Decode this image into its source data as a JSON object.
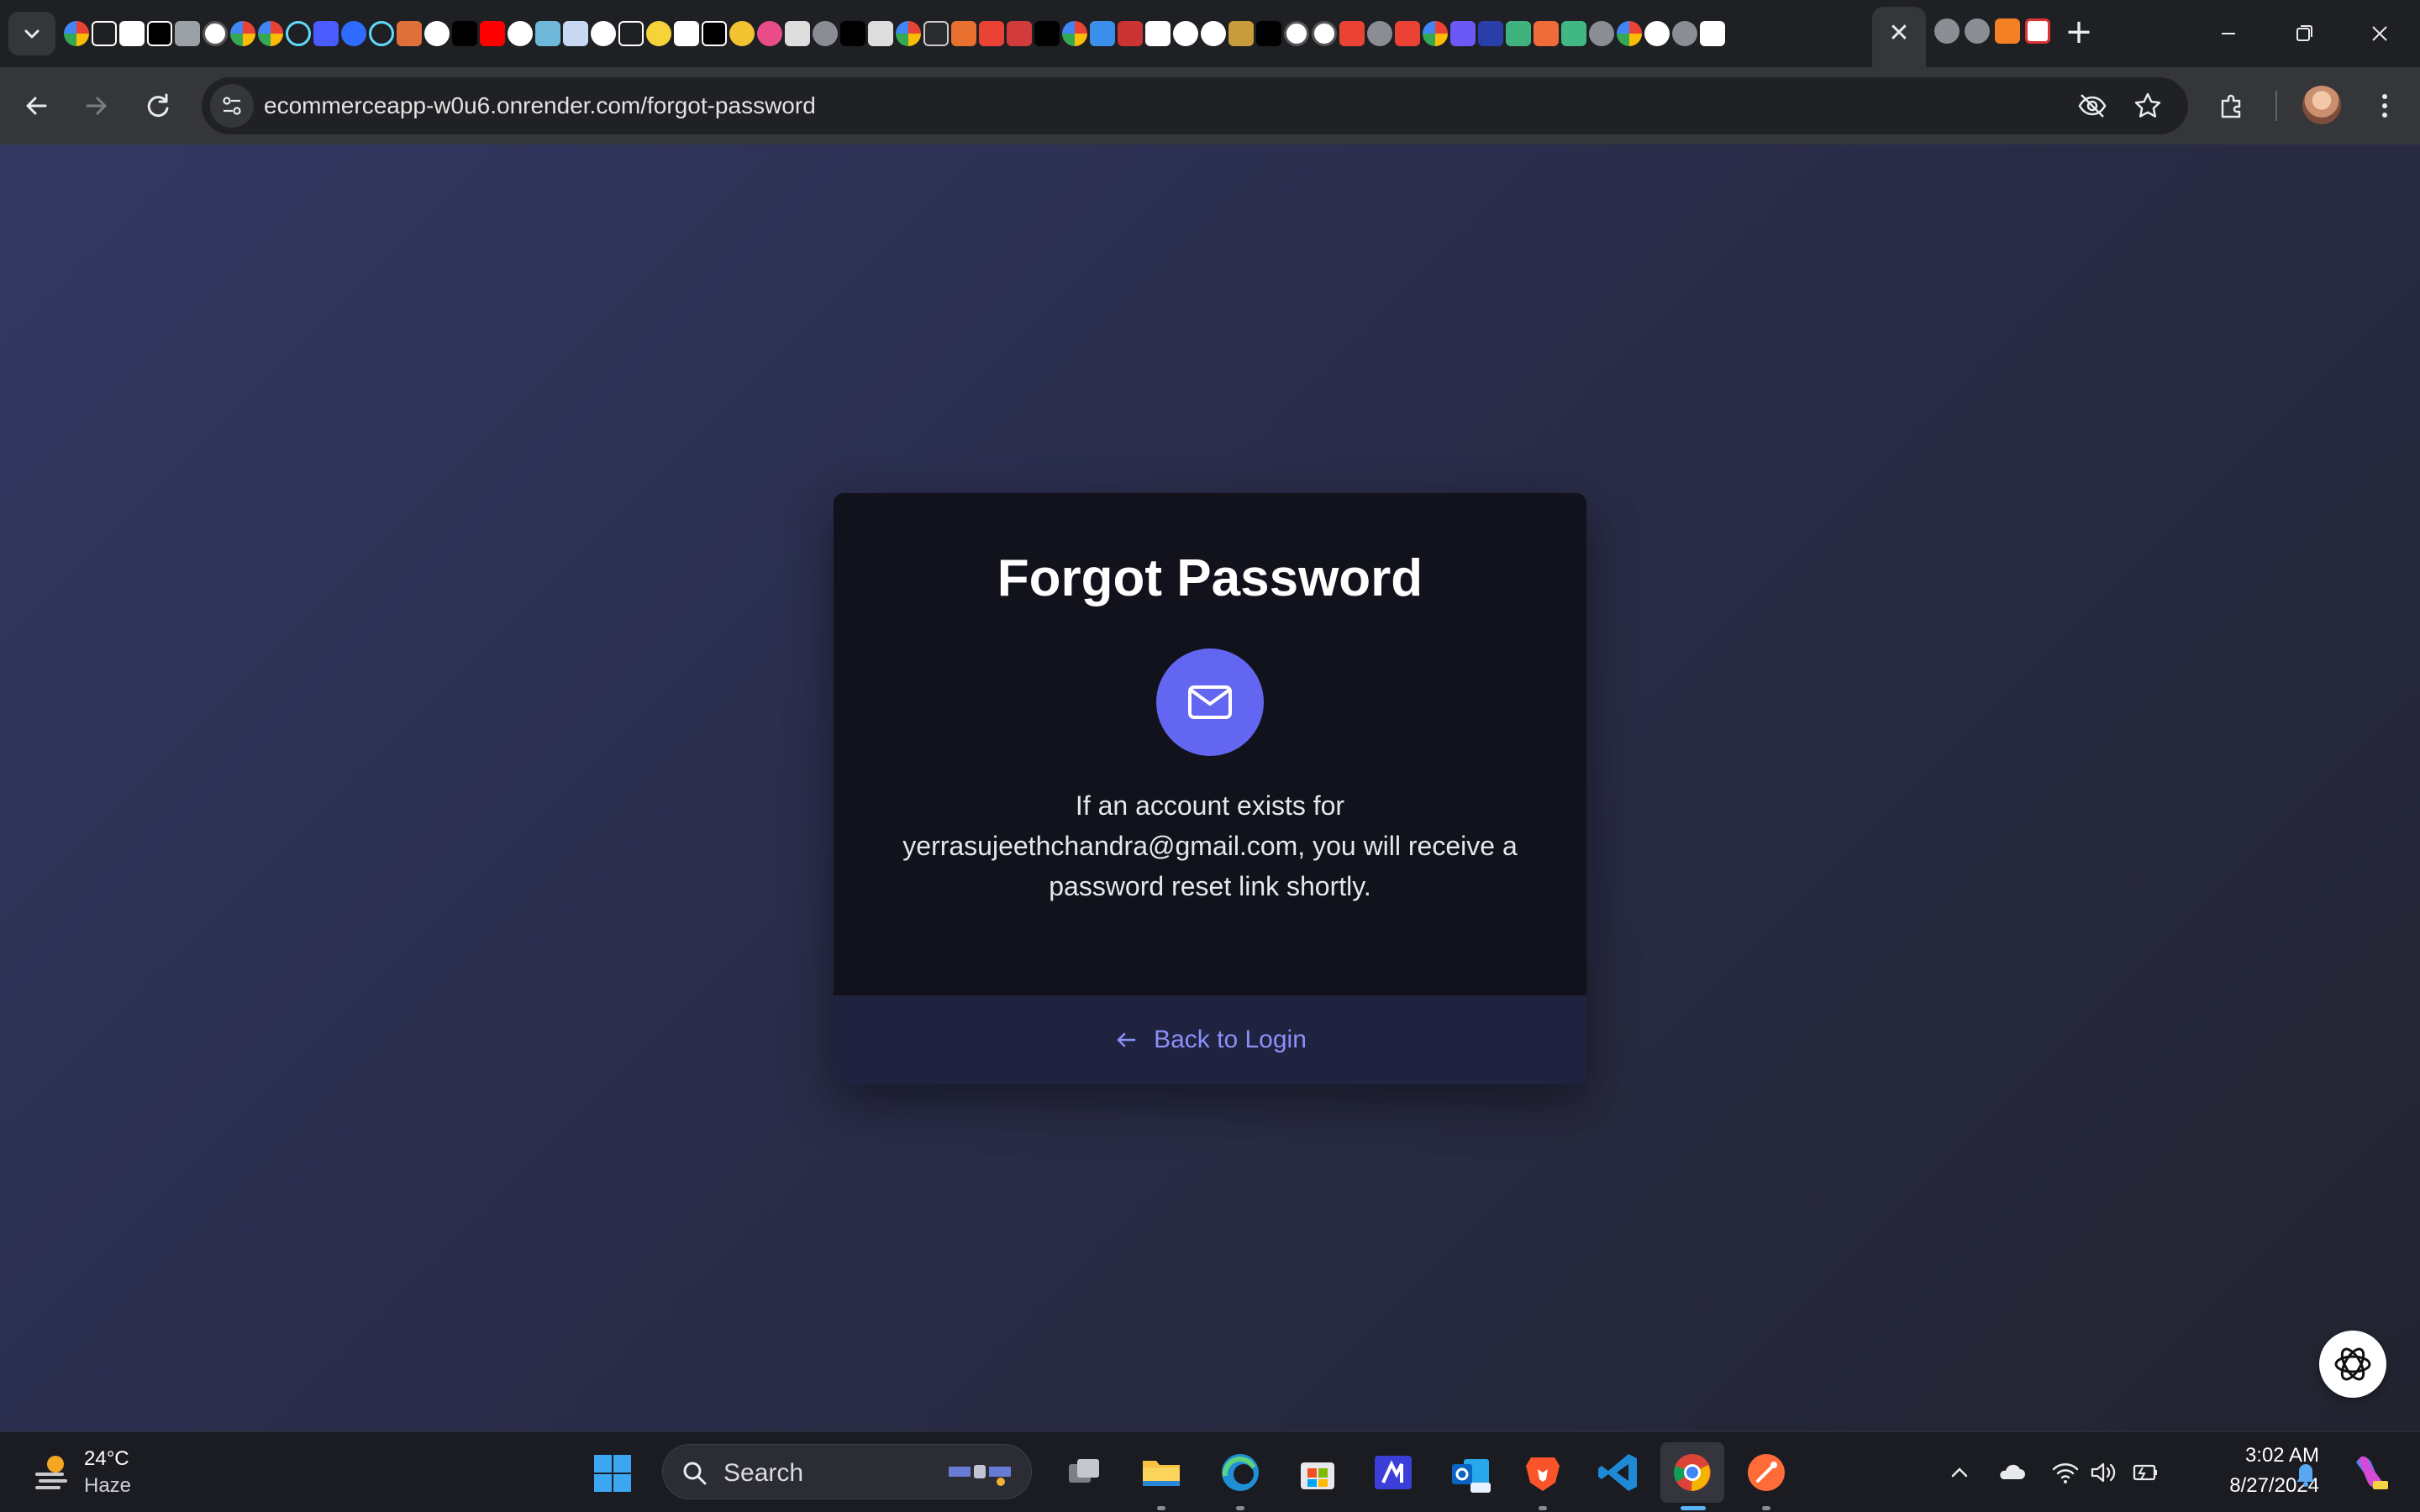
{
  "browser": {
    "active_tab_close": "✕",
    "new_tab": "+",
    "url": "ecommerceapp-w0u6.onrender.com/forgot-password"
  },
  "page": {
    "title": "Forgot Password",
    "message": "If an account exists for yerrasujeethchandra@gmail.com, you will receive a password reset link shortly.",
    "back_link": "Back to Login",
    "accent_color": "#6366f1",
    "link_color": "#8b8ff7"
  },
  "taskbar": {
    "weather_temp": "24°C",
    "weather_desc": "Haze",
    "search_label": "Search",
    "time": "3:02 AM",
    "date": "8/27/2024"
  }
}
